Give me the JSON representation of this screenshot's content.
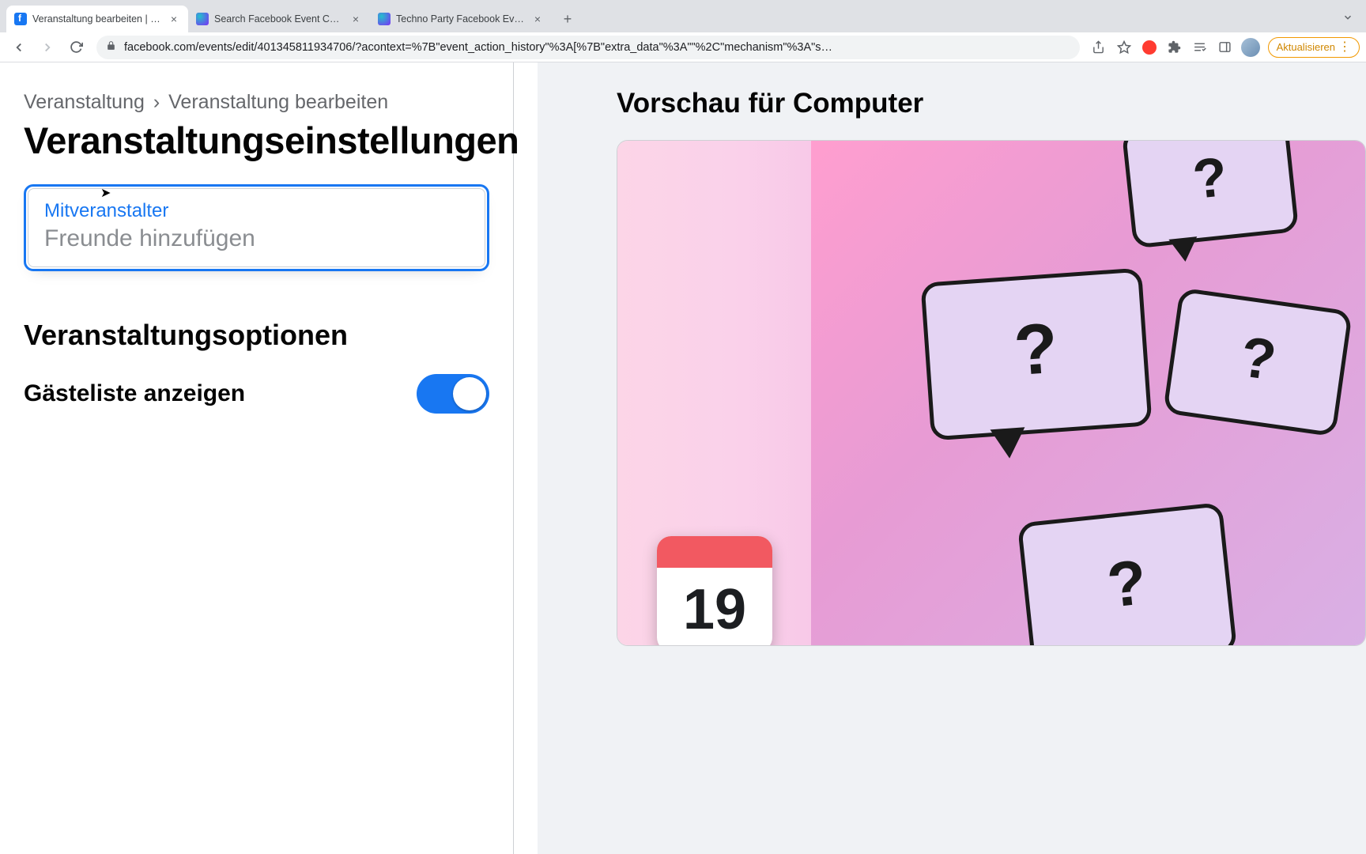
{
  "browser": {
    "tabs": [
      {
        "title": "Veranstaltung bearbeiten | Fac",
        "active": true,
        "favicon": "facebook"
      },
      {
        "title": "Search Facebook Event Cover",
        "active": false,
        "favicon": "canva"
      },
      {
        "title": "Techno Party Facebook Event",
        "active": false,
        "favicon": "canva"
      }
    ],
    "url": "facebook.com/events/edit/401345811934706/?acontext=%7B\"event_action_history\"%3A[%7B\"extra_data\"%3A\"\"%2C\"mechanism\"%3A\"s…",
    "update_label": "Aktualisieren"
  },
  "page": {
    "breadcrumb": {
      "root": "Veranstaltung",
      "current": "Veranstaltung bearbeiten"
    },
    "heading": "Veranstaltungseinstellungen",
    "cohost": {
      "label": "Mitveranstalter",
      "placeholder": "Freunde hinzufügen",
      "value": ""
    },
    "options_heading": "Veranstaltungsoptionen",
    "guestlist": {
      "label": "Gästeliste anzeigen",
      "enabled": true
    },
    "preview": {
      "title": "Vorschau für Computer",
      "calendar_day": "19"
    }
  }
}
